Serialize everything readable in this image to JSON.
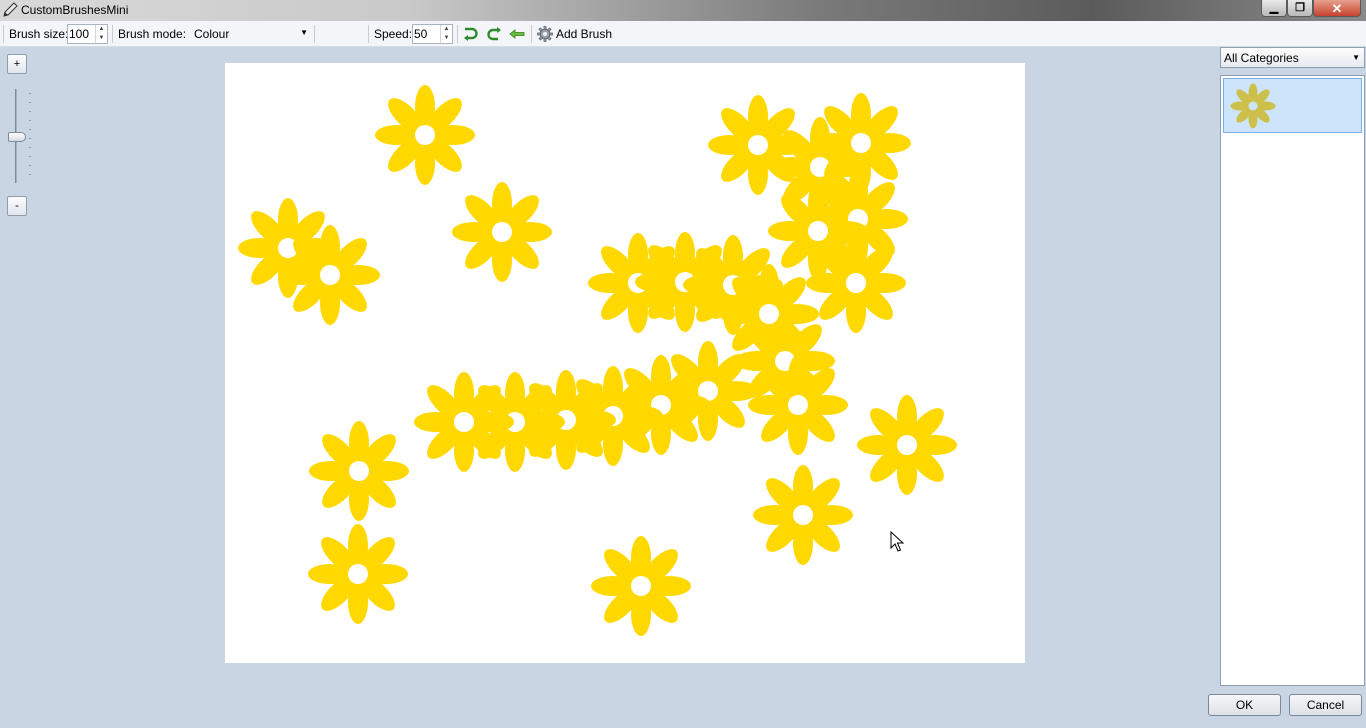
{
  "window": {
    "title": "CustomBrushesMini",
    "minimize_icon": "minimize-icon",
    "maximize_icon": "restore-icon",
    "close_icon": "close-icon"
  },
  "toolbar": {
    "brush_size_label": "Brush size:",
    "brush_size_value": "100",
    "brush_mode_label": "Brush mode:",
    "brush_mode_value": "Colour",
    "speed_label": "Speed:",
    "speed_value": "50",
    "undo_icon": "undo-icon",
    "redo_icon": "redo-icon",
    "back_icon": "arrow-left-icon",
    "add_brush_icon": "gear-icon",
    "add_brush_label": "Add Brush"
  },
  "zoom": {
    "plus_label": "+",
    "minus_label": "-"
  },
  "canvas": {
    "brush_color": "#ffd800"
  },
  "side_panel": {
    "category_value": "All Categories",
    "selected_brush_color": "#cdc04a"
  },
  "dialog": {
    "ok_label": "OK",
    "cancel_label": "Cancel"
  }
}
